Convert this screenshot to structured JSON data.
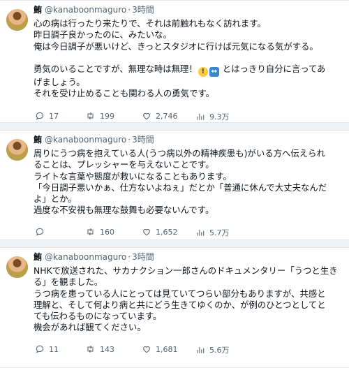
{
  "tweets": [
    {
      "display_name": "鮪",
      "handle": "@kanaboonmaguro",
      "separator": "·",
      "time": "3時間",
      "lines": [
        "心の病は行ったり来たりで、それは前触れもなく訪れます。",
        "昨日調子良かったのに、みたいな。",
        "俺は今日調子が悪いけど、きっとスタジオに行けば元気になる気がする。",
        "",
        "勇気のいることですが、無理な時は無理！ とはっきり自分に言ってあ",
        "げましょう。",
        "それを受け止めることも関わる人の勇気です。"
      ],
      "replies": "17",
      "retweets": "199",
      "likes": "2,746",
      "views": "9.3万"
    },
    {
      "display_name": "鮪",
      "handle": "@kanaboonmaguro",
      "separator": "·",
      "time": "3時間",
      "lines": [
        "周りにうつ病を抱えている人(うつ病以外の精神疾患も)がいる方へ伝えられ",
        "ることは、プレッシャーを与えないことです。",
        "ライトな言葉や態度が救いになることもあります。",
        "「今日調子悪いかぁ、仕方ないよねぇ」だとか「普通に休んで大丈夫なんだ",
        "よ」とか。",
        "過度な不安視も無理な鼓舞も必要ないんです。"
      ],
      "replies": "",
      "retweets": "160",
      "likes": "1,652",
      "views": "5.7万"
    },
    {
      "display_name": "鮪",
      "handle": "@kanaboonmaguro",
      "separator": "·",
      "time": "3時間",
      "lines": [
        "NHKで放送された、サカナクション一郎さんのドキュメンタリー「うつと生き",
        "る」を観ました。",
        "うつ病を患っている人にとっては見ていてつらい部分もありますが、共感と",
        "理解と、そして何より病と共にどう生きてゆくのか、が例のひとつとしてと",
        "ても伝わるものになっています。",
        "機会があれば観てください。"
      ],
      "replies": "11",
      "retweets": "143",
      "likes": "1,681",
      "views": "5.6万"
    }
  ],
  "icons": {
    "reply": "reply-icon",
    "retweet": "retweet-icon",
    "like": "heart-icon",
    "views": "views-icon",
    "emoji_1": "exclamation-emoji-icon",
    "emoji_2": "left-right-arrow-emoji-icon"
  },
  "colors": {
    "text": "#0f1419",
    "secondary": "#536471",
    "background": "#f0f2f4"
  }
}
